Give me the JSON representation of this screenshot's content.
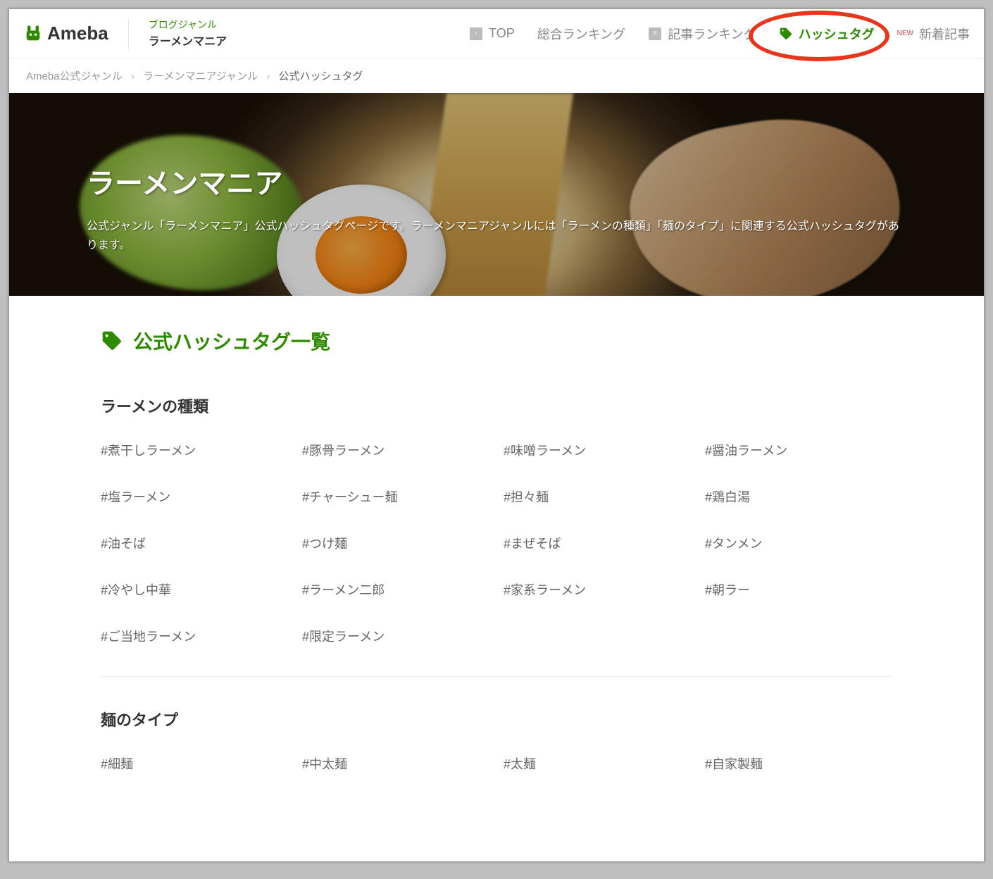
{
  "header": {
    "brand": "Ameba",
    "genre_label": "ブログジャンル",
    "genre_name": "ラーメンマニア"
  },
  "nav": {
    "top": "TOP",
    "overall_ranking": "総合ランキング",
    "article_ranking": "記事ランキング",
    "hashtag": "ハッシュタグ",
    "new_article": "新着記事",
    "new_badge": "NEW"
  },
  "breadcrumb": {
    "item1": "Ameba公式ジャンル",
    "item2": "ラーメンマニアジャンル",
    "current": "公式ハッシュタグ",
    "sep": "›"
  },
  "hero": {
    "title": "ラーメンマニア",
    "desc": "公式ジャンル「ラーメンマニア」公式ハッシュタグページです。ラーメンマニアジャンルには「ラーメンの種類」「麺のタイプ」に関連する公式ハッシュタグがあります。"
  },
  "section_title": "公式ハッシュタグ一覧",
  "categories": [
    {
      "title": "ラーメンの種類",
      "tags": [
        "#煮干しラーメン",
        "#豚骨ラーメン",
        "#味噌ラーメン",
        "#醤油ラーメン",
        "#塩ラーメン",
        "#チャーシュー麺",
        "#担々麺",
        "#鶏白湯",
        "#油そば",
        "#つけ麺",
        "#まぜそば",
        "#タンメン",
        "#冷やし中華",
        "#ラーメン二郎",
        "#家系ラーメン",
        "#朝ラー",
        "#ご当地ラーメン",
        "#限定ラーメン"
      ]
    },
    {
      "title": "麺のタイプ",
      "tags": [
        "#細麺",
        "#中太麺",
        "#太麺",
        "#自家製麺"
      ]
    }
  ]
}
